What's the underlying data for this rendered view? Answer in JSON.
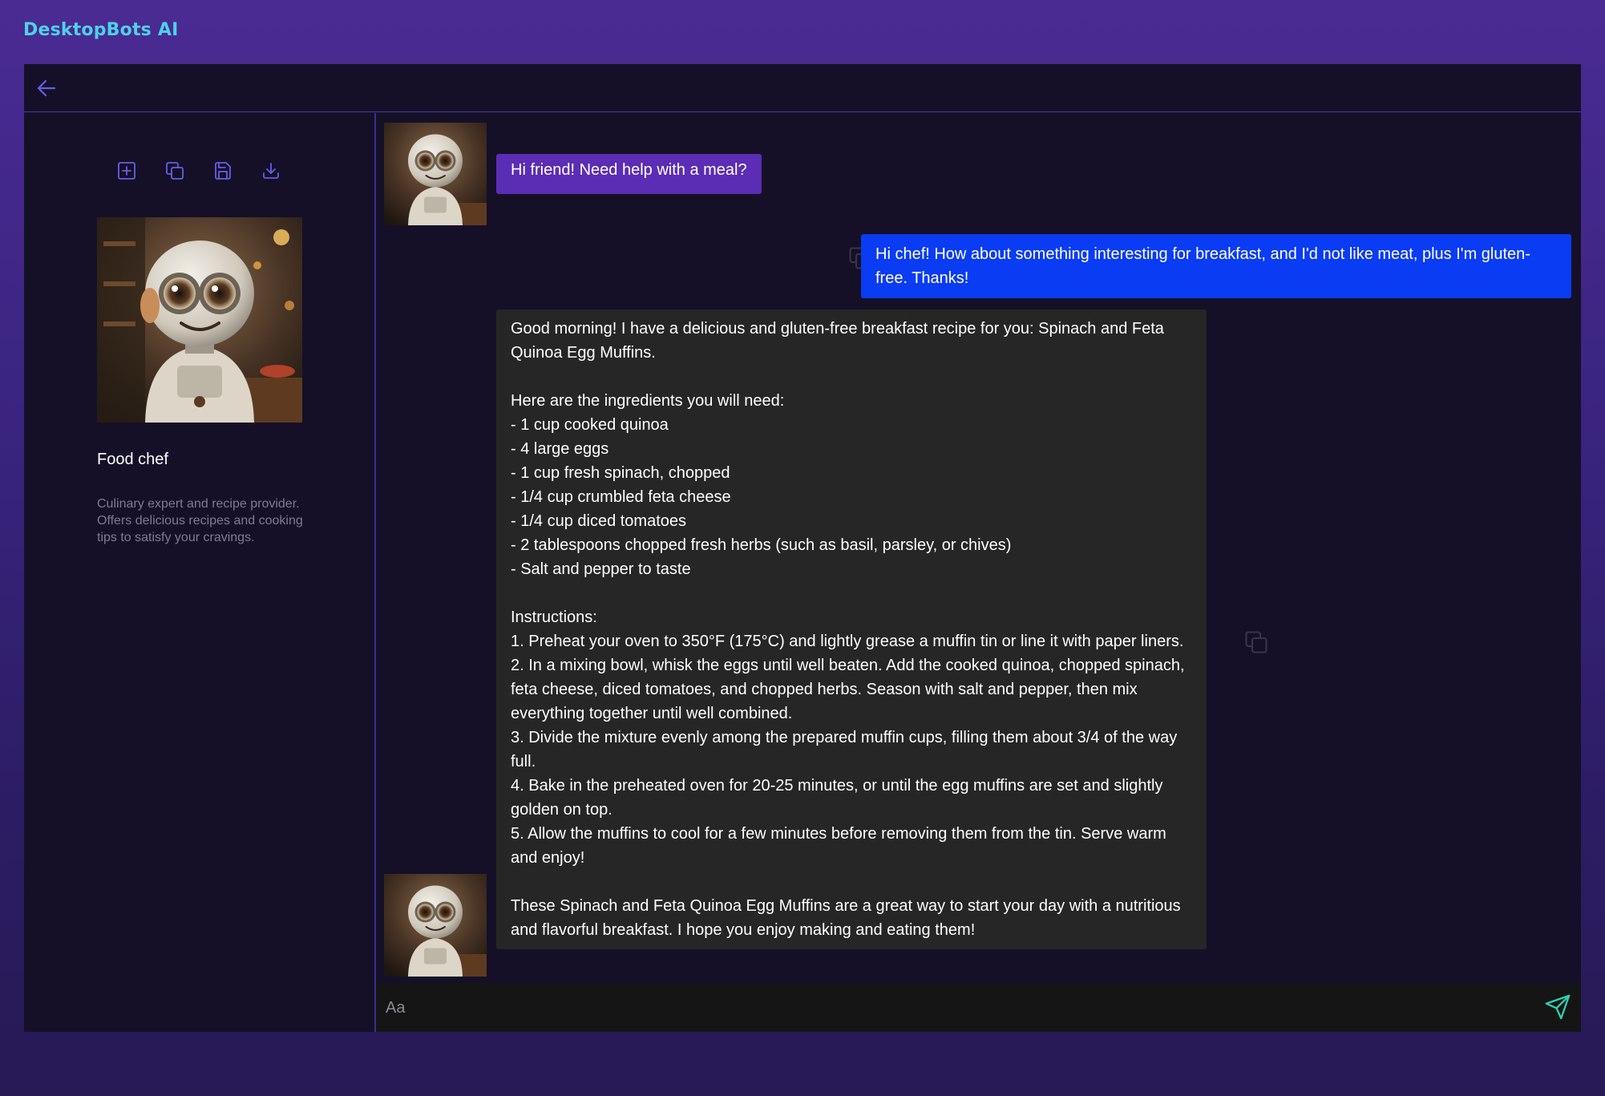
{
  "app": {
    "brand": "DesktopBots AI"
  },
  "sidebar": {
    "tools": [
      {
        "name": "add",
        "icon": "plus-square-icon"
      },
      {
        "name": "duplicate",
        "icon": "copy-icon"
      },
      {
        "name": "save",
        "icon": "save-icon"
      },
      {
        "name": "download",
        "icon": "download-icon"
      }
    ],
    "bot": {
      "name": "Food chef",
      "description": "Culinary expert and recipe provider. Offers delicious recipes and cooking tips to satisfy your cravings."
    }
  },
  "chat": {
    "messages": [
      {
        "role": "bot",
        "text": "Hi friend! Need help with a meal?"
      },
      {
        "role": "user",
        "text": "Hi chef! How about something interesting for breakfast, and I'd not like meat, plus I'm gluten-free. Thanks!"
      },
      {
        "role": "bot",
        "text": "Good morning! I have a delicious and gluten-free breakfast recipe for you: Spinach and Feta Quinoa Egg Muffins.\n\nHere are the ingredients you will need:\n- 1 cup cooked quinoa\n- 4 large eggs\n- 1 cup fresh spinach, chopped\n- 1/4 cup crumbled feta cheese\n- 1/4 cup diced tomatoes\n- 2 tablespoons chopped fresh herbs (such as basil, parsley, or chives)\n- Salt and pepper to taste\n\nInstructions:\n1. Preheat your oven to 350°F (175°C) and lightly grease a muffin tin or line it with paper liners.\n2. In a mixing bowl, whisk the eggs until well beaten. Add the cooked quinoa, chopped spinach, feta cheese, diced tomatoes, and chopped herbs. Season with salt and pepper, then mix everything together until well combined.\n3. Divide the mixture evenly among the prepared muffin cups, filling them about 3/4 of the way full.\n4. Bake in the preheated oven for 20-25 minutes, or until the egg muffins are set and slightly golden on top.\n5. Allow the muffins to cool for a few minutes before removing them from the tin. Serve warm and enjoy!\n\nThese Spinach and Feta Quinoa Egg Muffins are a great way to start your day with a nutritious and flavorful breakfast. I hope you enjoy making and eating them!"
      }
    ],
    "composer": {
      "placeholder": "Aa"
    }
  },
  "colors": {
    "brand": "#4fd1e8",
    "accent": "#6a5ce6",
    "bot_bubble_first": "#5b2db5",
    "user_bubble": "#0a3cf3",
    "bot_bubble": "#262626",
    "send_icon": "#2fd1b0"
  }
}
